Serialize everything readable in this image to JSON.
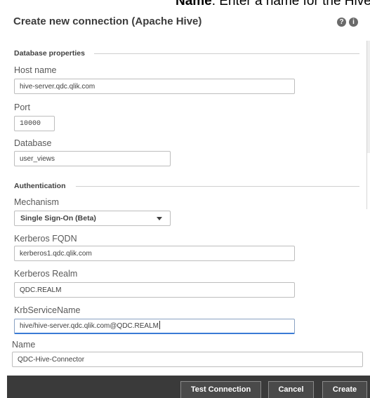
{
  "caption": {
    "bold": "Name",
    "text": ": Enter a name for the Hive connector"
  },
  "dialog": {
    "title": "Create new connection (Apache Hive)",
    "help_icon": "question-circle-icon",
    "info_icon": "info-circle-icon"
  },
  "sections": {
    "database": "Database properties",
    "authentication": "Authentication"
  },
  "fields": {
    "host": {
      "label": "Host name",
      "value": "hive-server.qdc.qlik.com"
    },
    "port": {
      "label": "Port",
      "value": "10000"
    },
    "database": {
      "label": "Database",
      "value": "user_views"
    },
    "mechanism": {
      "label": "Mechanism",
      "value": "Single Sign-On (Beta)"
    },
    "kerberos_fqdn": {
      "label": "Kerberos FQDN",
      "value": "kerberos1.qdc.qlik.com"
    },
    "kerberos_realm": {
      "label": "Kerberos Realm",
      "value": "QDC.REALM"
    },
    "krb_service_name": {
      "label": "KrbServiceName",
      "value": "hive/hive-server.qdc.qlik.com@QDC.REALM"
    },
    "name": {
      "label": "Name",
      "value": "QDC-Hive-Connector"
    }
  },
  "footer": {
    "test_connection": "Test Connection",
    "cancel": "Cancel",
    "create": "Create"
  },
  "colors": {
    "footer_bg": "#3a3a3a",
    "focus_accent": "#3a7bd5"
  }
}
